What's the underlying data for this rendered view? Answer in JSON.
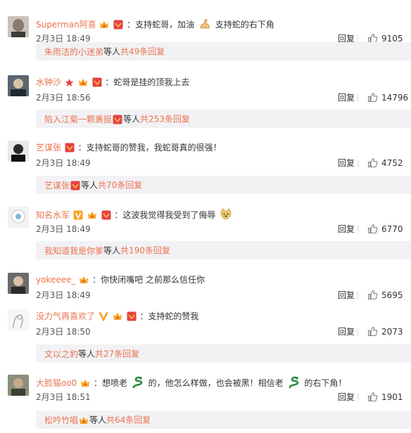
{
  "comments": [
    {
      "user": "Superman阿喜",
      "segments": [
        "：支持蛇哥，加油",
        "支持蛇的右下角"
      ],
      "date": "2月3日 18:49",
      "reply_label": "回复",
      "likes": "9105",
      "sub": {
        "user": "朱雨洁的小迷弟",
        "rest": "等人",
        "count": "共49条回复"
      }
    },
    {
      "user": "水钟沙",
      "segments": [
        "：蛇哥是挂的顶我上去"
      ],
      "date": "2月3日 18:56",
      "reply_label": "回复",
      "likes": "14796",
      "sub": {
        "user": "陷入江菊一颗裹挺",
        "rest": "等人",
        "count": "共253条回复"
      }
    },
    {
      "user": "艺谋张",
      "segments": [
        "：支持蛇哥的赞我，我蛇哥真的很强！"
      ],
      "date": "2月3日 18:49",
      "reply_label": "回复",
      "likes": "4752",
      "sub": {
        "user": "艺谋张",
        "rest": "等人",
        "count": "共70条回复"
      }
    },
    {
      "user": "知名水军",
      "segments": [
        "：这波我觉得我受到了侮辱"
      ],
      "date": "2月3日 18:49",
      "reply_label": "回复",
      "likes": "6770",
      "sub": {
        "user": "我知道我是你爹",
        "rest": "等人",
        "count": "共190条回复"
      }
    },
    {
      "user": "yokeeee_",
      "segments": [
        "：你快闭嘴吧 之前那么信任你"
      ],
      "date": "2月3日 18:49",
      "reply_label": "回复",
      "likes": "5695"
    },
    {
      "user": "没力气再喜欢了",
      "segments": [
        "：支持蛇的赞我"
      ],
      "date": "2月3日 18:50",
      "reply_label": "回复",
      "likes": "2073",
      "sub": {
        "user": "文以之豹",
        "rest": "等人",
        "count": "共27条回复"
      }
    },
    {
      "user": "大脸猫oo0",
      "segments": [
        "：想喷老",
        "的，他怎么样做，也会被黑！相信老",
        "的右下角！"
      ],
      "date": "2月3日 18:51",
      "reply_label": "回复",
      "likes": "1901",
      "sub": {
        "user": "松吟竹唱",
        "rest": "等人",
        "count": "共64条回复"
      }
    }
  ],
  "colors": {
    "username": "#eb7350",
    "text": "#333333",
    "subbox_bg": "#f2f2f5",
    "badge_red": "#e64141",
    "badge_gold": "#f5c242"
  },
  "icons": [
    "thumb-up-icon",
    "member-crown-icon",
    "fan-badge-icon",
    "verified-v-icon",
    "star-icon",
    "muscle-emoji",
    "doge-emoji",
    "snake-emoji"
  ]
}
